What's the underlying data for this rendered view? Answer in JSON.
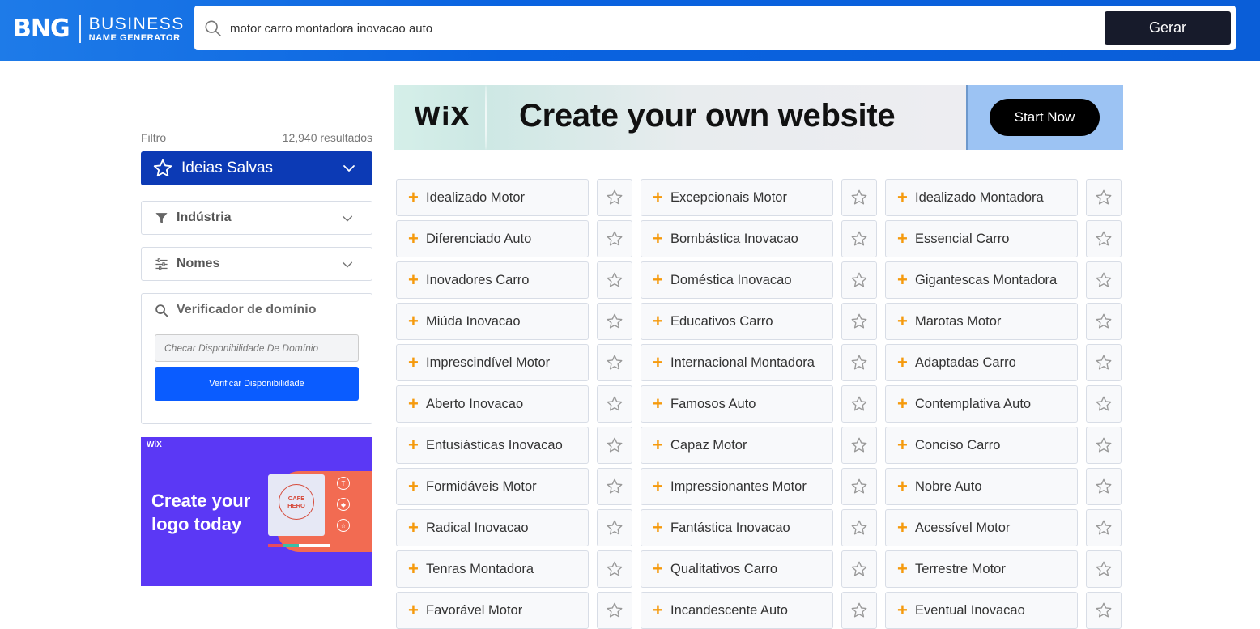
{
  "header": {
    "logo_mark": "BNG",
    "logo_line1": "BUSINESS",
    "logo_line2": "NAME GENERATOR",
    "search_value": "motor carro montadora inovacao auto",
    "generate_label": "Gerar"
  },
  "sidebar": {
    "filter_label": "Filtro",
    "results_count": "12,940 resultados",
    "saved_label": "Ideias Salvas",
    "industry_label": "Indústria",
    "names_label": "Nomes",
    "domain_title": "Verificador de domínio",
    "domain_placeholder": "Checar Disponibilidade De Domínio",
    "verify_label": "Verificar Disponibilidade"
  },
  "side_ad": {
    "brand": "WiX",
    "headline_line1": "Create your",
    "headline_line2": "logo today",
    "card_line1": "CAFE",
    "card_line2": "HERO"
  },
  "banner": {
    "brand": "WiX",
    "headline": "Create your own  website",
    "cta": "Start Now"
  },
  "colors": {
    "header_blue": "#0a63e0",
    "saved_blue": "#0c3ab5",
    "verify_blue": "#0a5cff",
    "plus_orange": "#f59a0d",
    "gerar_dark": "#171b2b"
  },
  "results": [
    [
      "Idealizado Motor",
      "Excepcionais Motor",
      "Idealizado Montadora"
    ],
    [
      "Diferenciado Auto",
      "Bombástica Inovacao",
      "Essencial Carro"
    ],
    [
      "Inovadores Carro",
      "Doméstica Inovacao",
      "Gigantescas Montadora"
    ],
    [
      "Miúda Inovacao",
      "Educativos Carro",
      "Marotas Motor"
    ],
    [
      "Imprescindível Motor",
      "Internacional Montadora",
      "Adaptadas Carro"
    ],
    [
      "Aberto Inovacao",
      "Famosos Auto",
      "Contemplativa Auto"
    ],
    [
      "Entusiásticas Inovacao",
      "Capaz Motor",
      "Conciso Carro"
    ],
    [
      "Formidáveis Motor",
      "Impressionantes Motor",
      "Nobre Auto"
    ],
    [
      "Radical Inovacao",
      "Fantástica Inovacao",
      "Acessível Motor"
    ],
    [
      "Tenras Montadora",
      "Qualitativos Carro",
      "Terrestre Motor"
    ],
    [
      "Favorável Motor",
      "Incandescente Auto",
      "Eventual Inovacao"
    ]
  ]
}
